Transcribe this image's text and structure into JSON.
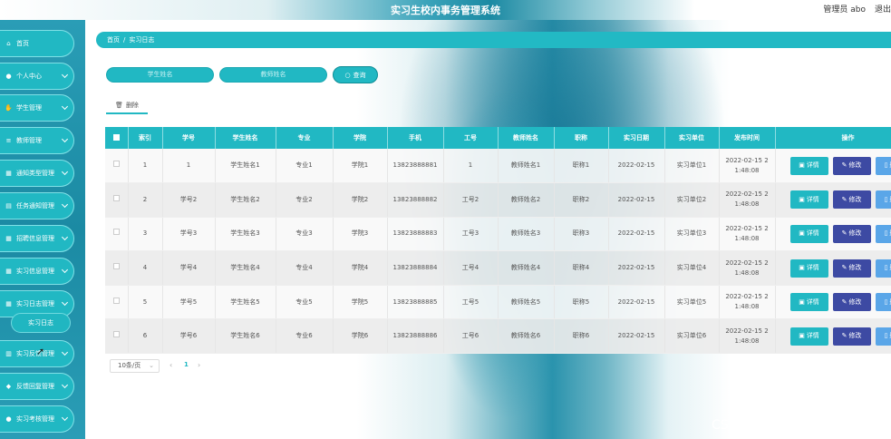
{
  "header": {
    "title": "实习生校内事务管理系统",
    "admin": "管理员 abo",
    "logout": "退出"
  },
  "sidebar": {
    "items": [
      {
        "label": "首页",
        "icon": "home-icon",
        "glyph": "⌂",
        "chevron": false
      },
      {
        "label": "个人中心",
        "icon": "user-icon",
        "glyph": "●",
        "chevron": true
      },
      {
        "label": "学生管理",
        "icon": "handshake-icon",
        "glyph": "✋",
        "chevron": true
      },
      {
        "label": "教师管理",
        "icon": "list-icon",
        "glyph": "≡",
        "chevron": true
      },
      {
        "label": "通知类型管理",
        "icon": "grid-icon",
        "glyph": "▦",
        "chevron": true
      },
      {
        "label": "任务通知管理",
        "icon": "db-icon",
        "glyph": "▤",
        "chevron": true
      },
      {
        "label": "招聘信息管理",
        "icon": "grid-icon",
        "glyph": "▦",
        "chevron": true
      },
      {
        "label": "实习信息管理",
        "icon": "grid-icon",
        "glyph": "▦",
        "chevron": true
      },
      {
        "label": "实习日志管理",
        "icon": "grid-icon",
        "glyph": "▦",
        "chevron": true
      },
      {
        "label": "实习反馈管理",
        "icon": "bank-icon",
        "glyph": "▥",
        "chevron": true
      },
      {
        "label": "反馈回复管理",
        "icon": "location-icon",
        "glyph": "◆",
        "chevron": true
      },
      {
        "label": "实习考核管理",
        "icon": "person-icon",
        "glyph": "●",
        "chevron": true
      }
    ],
    "subitem": "实习日志"
  },
  "breadcrumb": {
    "home": "首页",
    "separator": "/",
    "current": "实习日志"
  },
  "search": {
    "student_placeholder": "学生姓名",
    "teacher_placeholder": "教师姓名",
    "button": "查询"
  },
  "toolbar": {
    "delete_label": "删除"
  },
  "table": {
    "headers": [
      "索引",
      "学号",
      "学生姓名",
      "专业",
      "学院",
      "手机",
      "工号",
      "教师姓名",
      "职称",
      "实习日期",
      "实习单位",
      "发布时间",
      "操作"
    ],
    "rows": [
      [
        "1",
        "1",
        "学生姓名1",
        "专业1",
        "学院1",
        "13823888881",
        "1",
        "教师姓名1",
        "职称1",
        "2022-02-15",
        "实习单位1",
        "2022-02-15 2\n1:48:08"
      ],
      [
        "2",
        "学号2",
        "学生姓名2",
        "专业2",
        "学院2",
        "13823888882",
        "工号2",
        "教师姓名2",
        "职称2",
        "2022-02-15",
        "实习单位2",
        "2022-02-15 2\n1:48:08"
      ],
      [
        "3",
        "学号3",
        "学生姓名3",
        "专业3",
        "学院3",
        "13823888883",
        "工号3",
        "教师姓名3",
        "职称3",
        "2022-02-15",
        "实习单位3",
        "2022-02-15 2\n1:48:08"
      ],
      [
        "4",
        "学号4",
        "学生姓名4",
        "专业4",
        "学院4",
        "13823888884",
        "工号4",
        "教师姓名4",
        "职称4",
        "2022-02-15",
        "实习单位4",
        "2022-02-15 2\n1:48:08"
      ],
      [
        "5",
        "学号5",
        "学生姓名5",
        "专业5",
        "学院5",
        "13823888885",
        "工号5",
        "教师姓名5",
        "职称5",
        "2022-02-15",
        "实习单位5",
        "2022-02-15 2\n1:48:08"
      ],
      [
        "6",
        "学号6",
        "学生姓名6",
        "专业6",
        "学院6",
        "13823888886",
        "工号6",
        "教师姓名6",
        "职称6",
        "2022-02-15",
        "实习单位6",
        "2022-02-15 2\n1:48:08"
      ]
    ],
    "actions": {
      "detail": "详情",
      "edit": "修改",
      "delete": "删除"
    }
  },
  "pagination": {
    "page_size": "10条/页",
    "current_page": "1",
    "prev": "‹",
    "next": "›",
    "dropdown": "⌄"
  },
  "watermark": "CSDN @锦浩学长_毕设"
}
